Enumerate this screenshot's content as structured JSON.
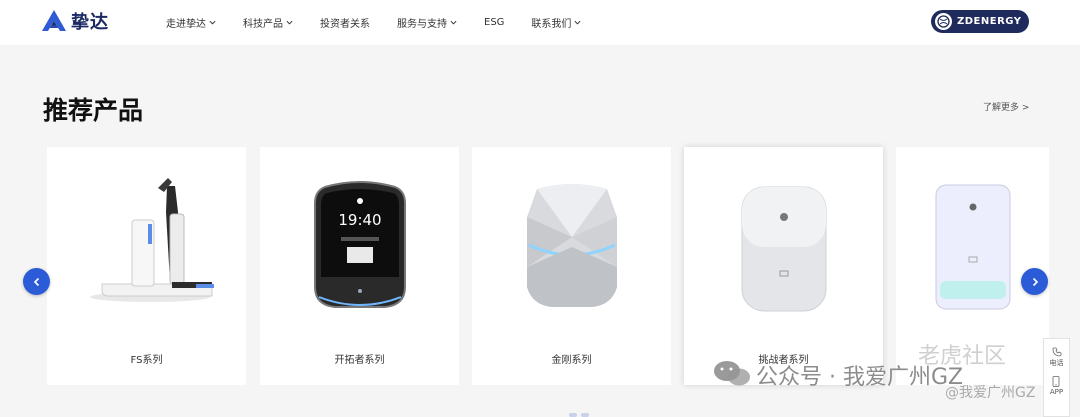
{
  "header": {
    "logo_text": "挚达",
    "nav": [
      {
        "label": "走进挚达",
        "has_dropdown": true
      },
      {
        "label": "科技产品",
        "has_dropdown": true
      },
      {
        "label": "投资者关系",
        "has_dropdown": false
      },
      {
        "label": "服务与支持",
        "has_dropdown": true
      },
      {
        "label": "ESG",
        "has_dropdown": false
      },
      {
        "label": "联系我们",
        "has_dropdown": true
      }
    ],
    "brand_badge": "ZDENERGY"
  },
  "section": {
    "title": "推荐产品",
    "more_link": "了解更多 >"
  },
  "products": [
    {
      "name": "FS系列",
      "icon": "robot-arm-charger"
    },
    {
      "name": "开拓者系列",
      "icon": "screen-charger",
      "screen_time": "19:40"
    },
    {
      "name": "金刚系列",
      "icon": "diamond-charger"
    },
    {
      "name": "挑战者系列",
      "icon": "rounded-charger"
    },
    {
      "name": "",
      "icon": "slim-charger"
    }
  ],
  "side_tools": {
    "phone": "电话",
    "app": "APP"
  },
  "watermark": {
    "line1": "公众号 · 我爱广州GZ",
    "line1b": "老虎社区",
    "line2": "@我爱广州GZ"
  },
  "colors": {
    "accent": "#2b5bd6",
    "brand_navy": "#1f2b5c",
    "page_bg": "#f5f5f5"
  }
}
